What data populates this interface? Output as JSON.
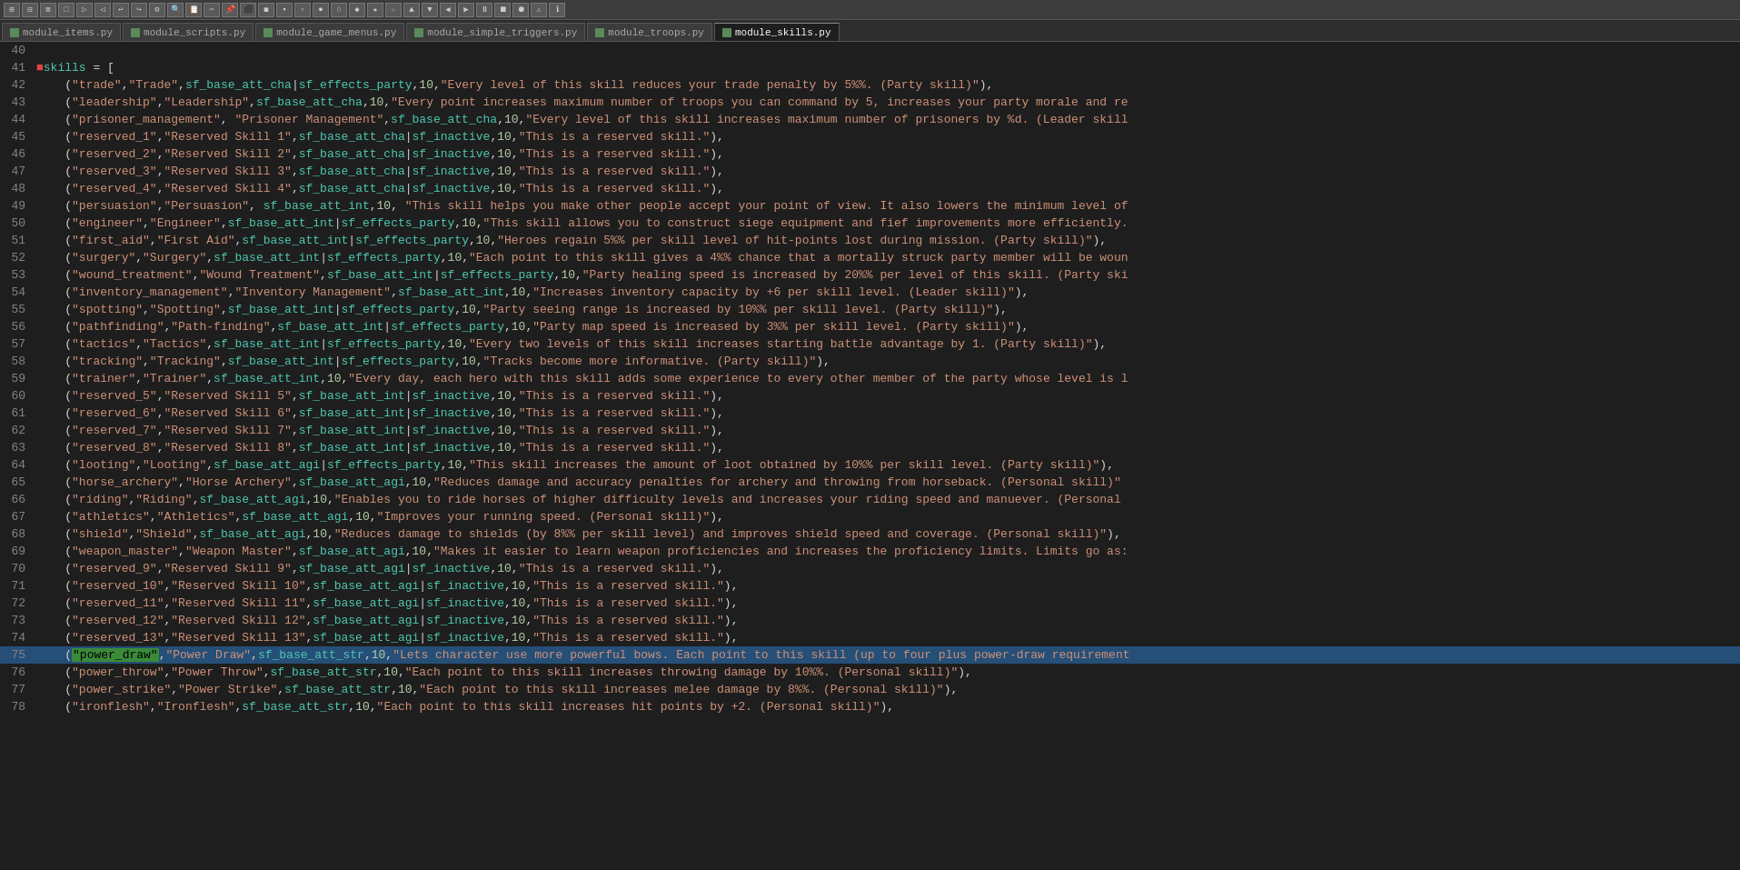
{
  "toolbar": {
    "buttons": [
      "⊞",
      "⊟",
      "⊠",
      "⊡",
      "▷",
      "◁",
      "↩",
      "↪",
      "⚙",
      "🔍",
      "📋",
      "✂",
      "📌",
      "⬛",
      "◼",
      "▪",
      "▫",
      "●",
      "○",
      "◆",
      "◇",
      "★",
      "☆",
      "▲",
      "▼",
      "◀",
      "▶",
      "⏸",
      "⏹",
      "⏺",
      "⚠",
      "ℹ"
    ]
  },
  "tabs": [
    {
      "label": "module_items.py",
      "active": false,
      "color": "#4a7a4a"
    },
    {
      "label": "module_scripts.py",
      "active": false,
      "color": "#4a7a4a"
    },
    {
      "label": "module_game_menus.py",
      "active": false,
      "color": "#4a7a4a"
    },
    {
      "label": "module_simple_triggers.py",
      "active": false,
      "color": "#4a7a4a"
    },
    {
      "label": "module_troops.py",
      "active": false,
      "color": "#4a7a4a"
    },
    {
      "label": "module_skills.py",
      "active": true,
      "color": "#4a7a4a"
    }
  ],
  "lines": [
    {
      "num": 40,
      "content": ""
    },
    {
      "num": 41,
      "content": "skills = [",
      "special": "assignment"
    },
    {
      "num": 42,
      "content": "  (\"trade\",\"Trade\",sf_base_att_cha|sf_effects_party,10,\"Every level of this skill reduces your trade penalty by 5%%. (Party skill)\"),"
    },
    {
      "num": 43,
      "content": "  (\"leadership\",\"Leadership\",sf_base_att_cha,10,\"Every point increases maximum number of troops you can command by 5, increases your party morale and re"
    },
    {
      "num": 44,
      "content": "  (\"prisoner_management\", \"Prisoner Management\",sf_base_att_cha,10,\"Every level of this skill increases maximum number of prisoners by %d. (Leader skill"
    },
    {
      "num": 45,
      "content": "  (\"reserved_1\",\"Reserved Skill 1\",sf_base_att_cha|sf_inactive,10,\"This is a reserved skill.\"),"
    },
    {
      "num": 46,
      "content": "  (\"reserved_2\",\"Reserved Skill 2\",sf_base_att_cha|sf_inactive,10,\"This is a reserved skill.\"),"
    },
    {
      "num": 47,
      "content": "  (\"reserved_3\",\"Reserved Skill 3\",sf_base_att_cha|sf_inactive,10,\"This is a reserved skill.\"),"
    },
    {
      "num": 48,
      "content": "  (\"reserved_4\",\"Reserved Skill 4\",sf_base_att_cha|sf_inactive,10,\"This is a reserved skill.\"),"
    },
    {
      "num": 49,
      "content": "  (\"persuasion\",\"Persuasion\", sf_base_att_int,10, \"This skill helps you make other people accept your point of view. It also lowers the minimum level of"
    },
    {
      "num": 50,
      "content": "  (\"engineer\",\"Engineer\",sf_base_att_int|sf_effects_party,10,\"This skill allows you to construct siege equipment and fief improvements more efficiently."
    },
    {
      "num": 51,
      "content": "  (\"first_aid\",\"First Aid\",sf_base_att_int|sf_effects_party,10,\"Heroes regain 5%% per skill level of hit-points lost during mission. (Party skill)\"),"
    },
    {
      "num": 52,
      "content": "  (\"surgery\",\"Surgery\",sf_base_att_int|sf_effects_party,10,\"Each point to this skill gives a 4%% chance that a mortally struck party member will be woun"
    },
    {
      "num": 53,
      "content": "  (\"wound_treatment\",\"Wound Treatment\",sf_base_att_int|sf_effects_party,10,\"Party healing speed is increased by 20%% per level of this skill. (Party ski"
    },
    {
      "num": 54,
      "content": "  (\"inventory_management\",\"Inventory Management\",sf_base_att_int,10,\"Increases inventory capacity by +6 per skill level. (Leader skill)\"),"
    },
    {
      "num": 55,
      "content": "  (\"spotting\",\"Spotting\",sf_base_att_int|sf_effects_party,10,\"Party seeing range is increased by 10%% per skill level. (Party skill)\"),"
    },
    {
      "num": 56,
      "content": "  (\"pathfinding\",\"Path-finding\",sf_base_att_int|sf_effects_party,10,\"Party map speed is increased by 3%% per skill level. (Party skill)\"),"
    },
    {
      "num": 57,
      "content": "  (\"tactics\",\"Tactics\",sf_base_att_int|sf_effects_party,10,\"Every two levels of this skill increases starting battle advantage by 1. (Party skill)\"),"
    },
    {
      "num": 58,
      "content": "  (\"tracking\",\"Tracking\",sf_base_att_int|sf_effects_party,10,\"Tracks become more informative. (Party skill)\"),"
    },
    {
      "num": 59,
      "content": "  (\"trainer\",\"Trainer\",sf_base_att_int,10,\"Every day, each hero with this skill adds some experience to every other member of the party whose level is l"
    },
    {
      "num": 60,
      "content": "  (\"reserved_5\",\"Reserved Skill 5\",sf_base_att_int|sf_inactive,10,\"This is a reserved skill.\"),"
    },
    {
      "num": 61,
      "content": "  (\"reserved_6\",\"Reserved Skill 6\",sf_base_att_int|sf_inactive,10,\"This is a reserved skill.\"),"
    },
    {
      "num": 62,
      "content": "  (\"reserved_7\",\"Reserved Skill 7\",sf_base_att_int|sf_inactive,10,\"This is a reserved skill.\"),"
    },
    {
      "num": 63,
      "content": "  (\"reserved_8\",\"Reserved Skill 8\",sf_base_att_int|sf_inactive,10,\"This is a reserved skill.\"),"
    },
    {
      "num": 64,
      "content": "  (\"looting\",\"Looting\",sf_base_att_agi|sf_effects_party,10,\"This skill increases the amount of loot obtained by 10%% per skill level. (Party skill)\"),"
    },
    {
      "num": 65,
      "content": "  (\"horse_archery\",\"Horse Archery\",sf_base_att_agi,10,\"Reduces damage and accuracy penalties for archery and throwing from horseback. (Personal skill)\""
    },
    {
      "num": 66,
      "content": "  (\"riding\",\"Riding\",sf_base_att_agi,10,\"Enables you to ride horses of higher difficulty levels and increases your riding speed and manuever. (Personal"
    },
    {
      "num": 67,
      "content": "  (\"athletics\",\"Athletics\",sf_base_att_agi,10,\"Improves your running speed. (Personal skill)\"),"
    },
    {
      "num": 68,
      "content": "  (\"shield\",\"Shield\",sf_base_att_agi,10,\"Reduces damage to shields (by 8%% per skill level) and improves shield speed and coverage. (Personal skill)\"),"
    },
    {
      "num": 69,
      "content": "  (\"weapon_master\",\"Weapon Master\",sf_base_att_agi,10,\"Makes it easier to learn weapon proficiencies and increases the proficiency limits. Limits go as:"
    },
    {
      "num": 70,
      "content": "  (\"reserved_9\",\"Reserved Skill 9\",sf_base_att_agi|sf_inactive,10,\"This is a reserved skill.\"),"
    },
    {
      "num": 71,
      "content": "  (\"reserved_10\",\"Reserved Skill 10\",sf_base_att_agi|sf_inactive,10,\"This is a reserved skill.\"),"
    },
    {
      "num": 72,
      "content": "  (\"reserved_11\",\"Reserved Skill 11\",sf_base_att_agi|sf_inactive,10,\"This is a reserved skill.\"),"
    },
    {
      "num": 73,
      "content": "  (\"reserved_12\",\"Reserved Skill 12\",sf_base_att_agi|sf_inactive,10,\"This is a reserved skill.\"),"
    },
    {
      "num": 74,
      "content": "  (\"reserved_13\",\"Reserved Skill 13\",sf_base_att_agi|sf_inactive,10,\"This is a reserved skill.\"),"
    },
    {
      "num": 75,
      "content": "  (\"power_draw\",\"Power Draw\",sf_base_att_str,10,\"Lets character use more powerful bows. Each point to this skill (up to four plus power-draw requirement",
      "highlighted": true
    },
    {
      "num": 76,
      "content": "  (\"power_throw\",\"Power Throw\",sf_base_att_str,10,\"Each point to this skill increases throwing damage by 10%%. (Personal skill)\"),"
    },
    {
      "num": 77,
      "content": "  (\"power_strike\",\"Power Strike\",sf_base_att_str,10,\"Each point to this skill increases melee damage by 8%%. (Personal skill)\"),"
    },
    {
      "num": 78,
      "content": "  (\"ironflesh\",\"Ironflesh\",sf_base_att_str,10,\"Each point to this skill increases hit points by +2. (Personal skill)\"),"
    }
  ]
}
